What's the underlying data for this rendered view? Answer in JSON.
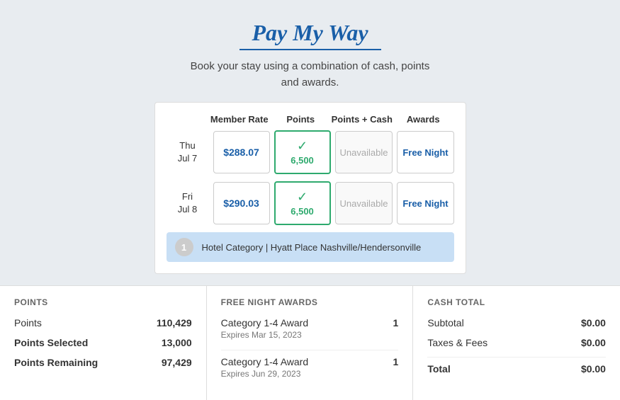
{
  "header": {
    "title": "Pay My Way",
    "subtitle_line1": "Book your stay using a combination of cash, points",
    "subtitle_line2": "and awards."
  },
  "table": {
    "columns": [
      "",
      "Member Rate",
      "Points",
      "Points + Cash",
      "Awards"
    ],
    "rows": [
      {
        "date_line1": "Thu",
        "date_line2": "Jul 7",
        "member_rate": "$288.07",
        "points_value": "6,500",
        "points_cash": "Unavailable",
        "awards": "Free Night"
      },
      {
        "date_line1": "Fri",
        "date_line2": "Jul 8",
        "member_rate": "$290.03",
        "points_value": "6,500",
        "points_cash": "Unavailable",
        "awards": "Free Night"
      }
    ],
    "hotel_category_badge": "1",
    "hotel_category_text": "Hotel Category | Hyatt Place Nashville/Hendersonville"
  },
  "points_panel": {
    "title": "POINTS",
    "rows": [
      {
        "label": "Points",
        "value": "110,429"
      },
      {
        "label": "Points Selected",
        "value": "13,000"
      },
      {
        "label": "Points Remaining",
        "value": "97,429"
      }
    ]
  },
  "free_night_panel": {
    "title": "FREE NIGHT AWARDS",
    "items": [
      {
        "award": "Category 1-4 Award",
        "expires": "Expires Mar 15, 2023",
        "count": "1"
      },
      {
        "award": "Category 1-4 Award",
        "expires": "Expires Jun 29, 2023",
        "count": "1"
      }
    ]
  },
  "cash_panel": {
    "title": "CASH TOTAL",
    "rows": [
      {
        "label": "Subtotal",
        "value": "$0.00"
      },
      {
        "label": "Taxes & Fees",
        "value": "$0.00"
      },
      {
        "label": "Total",
        "value": "$0.00"
      }
    ]
  }
}
